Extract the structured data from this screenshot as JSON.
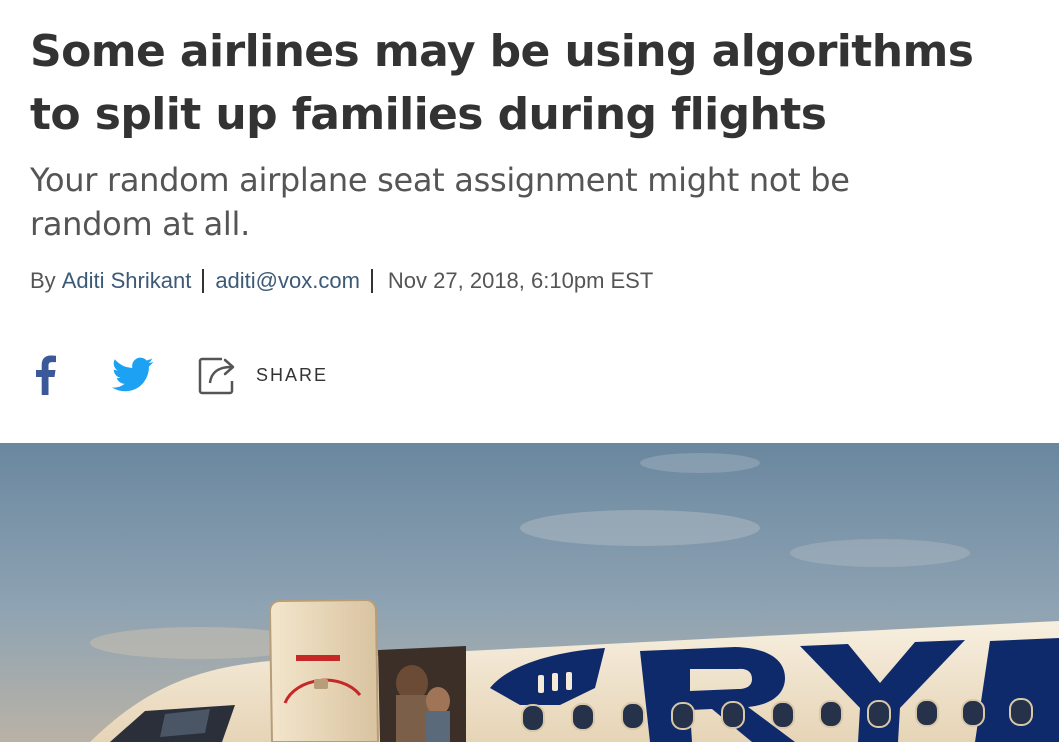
{
  "article": {
    "headline": "Some airlines may be using algorithms to split up families during flights",
    "dek": "Your random airplane seat assignment might not be random at all.",
    "byline": {
      "by_label": "By",
      "author": "Aditi Shrikant",
      "email": "aditi@vox.com",
      "date": "Nov 27, 2018, 6:10pm EST"
    }
  },
  "share": {
    "facebook_icon": "facebook-icon",
    "twitter_icon": "twitter-icon",
    "share_icon": "share-icon",
    "share_label": "SHARE"
  },
  "hero": {
    "alt": "Passengers boarding a Ryanair airplane at sunset",
    "livery_text": "RYANAIR",
    "colors": {
      "sky": "#6f8aa0",
      "fuselage": "#f3ead8",
      "livery_blue": "#0f2a6b",
      "door_frame": "#e9dcc2",
      "accent_red": "#c62828"
    }
  },
  "colors": {
    "headline": "#333333",
    "dek": "#555555",
    "link": "#3c5a78",
    "facebook": "#3b5998",
    "twitter": "#1da1f2"
  }
}
